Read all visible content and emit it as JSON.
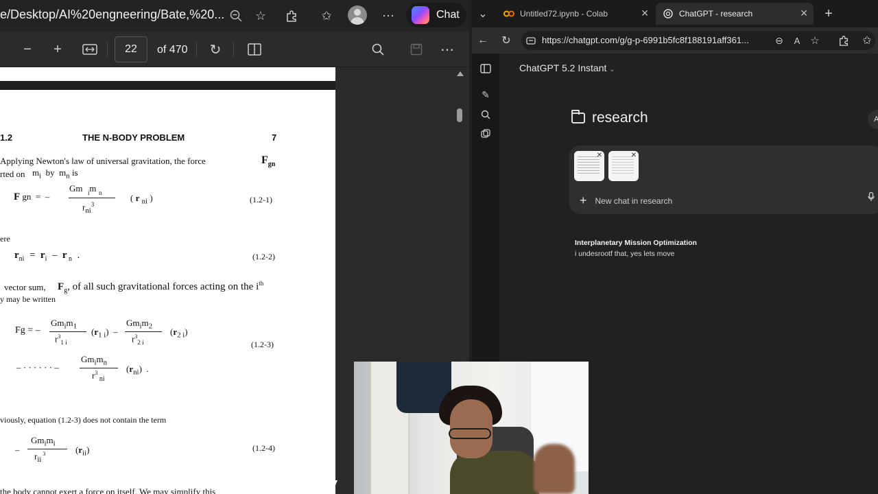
{
  "left_window": {
    "address_text": "e/Desktop/AI%20engneering/Bate,%20...",
    "copilot_label": "Chat",
    "toolbar": {
      "current_page": "22",
      "page_of": "of 470"
    },
    "pdf_page": {
      "section_number": "1.2",
      "running_head": "THE N-BODY PROBLEM",
      "page_number": "7",
      "lines": [
        "Applying  Newton's  law  of  universal  gravitation,  the  force",
        "rted on",
        "ere",
        "vector sum,",
        "y may be written",
        "viously, equation (1.2-3) does not contain the term",
        "the  body  cannot  exert  a  force  on  itself.  We  may  simplify  this"
      ],
      "equations": {
        "eq1_label": "(1.2-1)",
        "eq2_label": "(1.2-2)",
        "eq3_label": "(1.2-3)",
        "eq4_label": "(1.2-4)"
      }
    }
  },
  "right_window": {
    "tabs": [
      {
        "label": "Untitled72.ipynb - Colab",
        "icon": "colab-icon",
        "color": "#f9ab00"
      },
      {
        "label": "ChatGPT - research",
        "icon": "chatgpt-icon",
        "color": "#e0e0e0"
      }
    ],
    "url": "https://chatgpt.com/g/g-p-6991b5fc8f188191aff361...",
    "model_selector": "ChatGPT 5.2 Instant",
    "project_title": "research",
    "share_label": "A",
    "composer": {
      "placeholder": "New chat in research"
    },
    "chats": [
      {
        "title": "Interplanetary Mission Optimization",
        "preview": "i undesrootf that, yes lets move"
      }
    ]
  }
}
